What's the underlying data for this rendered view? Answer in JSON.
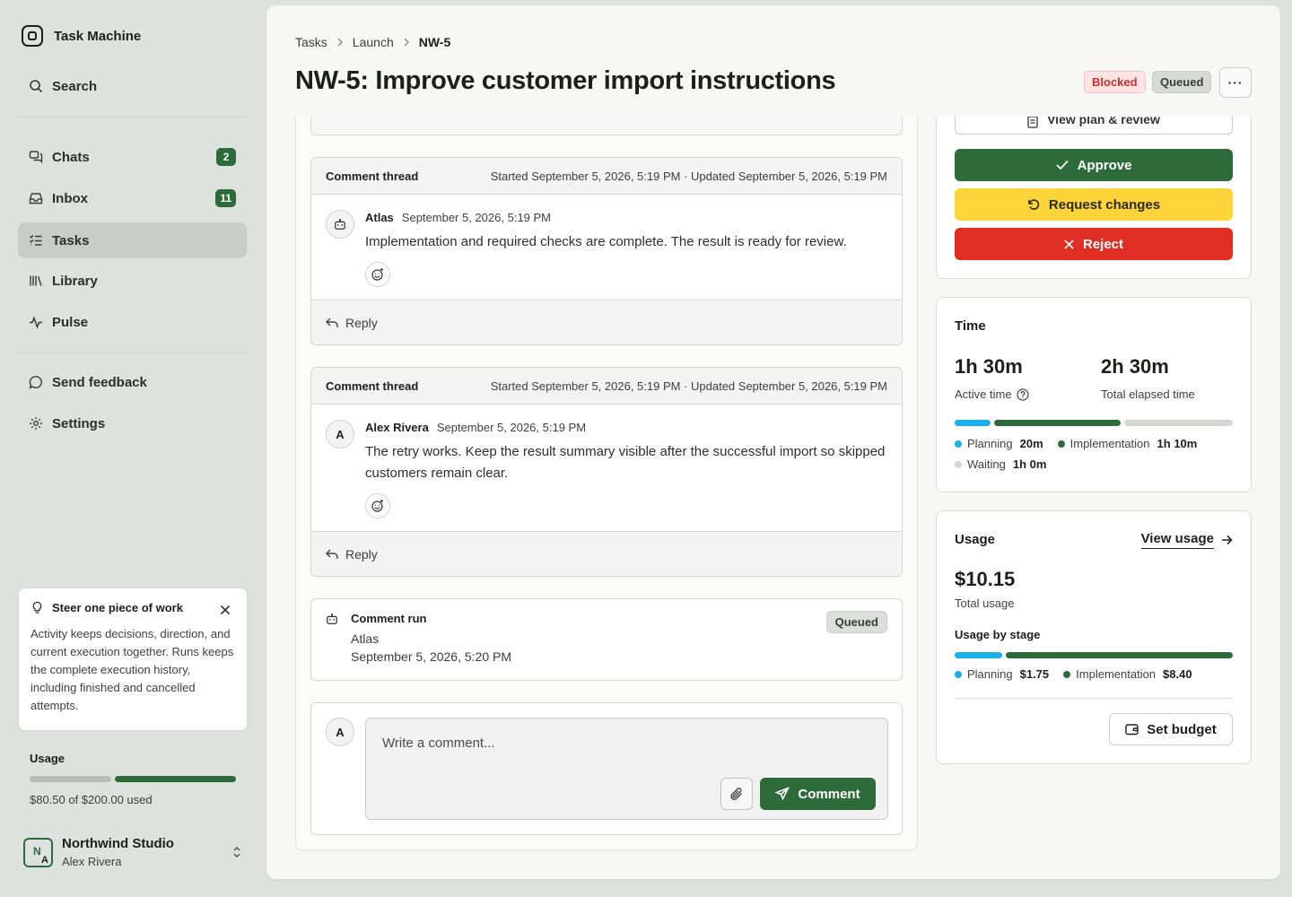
{
  "app": {
    "name": "Task Machine"
  },
  "sidebar": {
    "search_label": "Search",
    "items": [
      {
        "label": "Chats",
        "badge": "2"
      },
      {
        "label": "Inbox",
        "badge": "11"
      },
      {
        "label": "Tasks"
      },
      {
        "label": "Library"
      },
      {
        "label": "Pulse"
      }
    ],
    "feedback_label": "Send feedback",
    "settings_label": "Settings",
    "tip": {
      "title": "Steer one piece of work",
      "body": "Activity keeps decisions, direction, and current execution together. Runs keeps the complete execution history, including finished and cancelled attempts."
    },
    "usage": {
      "title": "Usage",
      "used_fraction": 0.4025,
      "text": "$80.50 of $200.00 used"
    },
    "workspace": {
      "name": "Northwind Studio",
      "user": "Alex Rivera",
      "initials_a": "N",
      "initials_b": "A"
    }
  },
  "header": {
    "breadcrumbs": [
      "Tasks",
      "Launch",
      "NW-5"
    ],
    "title": "NW-5: Improve customer import instructions",
    "status_blocked": "Blocked",
    "status_queued": "Queued",
    "more_label": "···"
  },
  "threads": [
    {
      "label": "Comment thread",
      "meta": "Started September 5, 2026, 5:19 PM · Updated September 5, 2026, 5:19 PM",
      "author": "Atlas",
      "time": "September 5, 2026, 5:19 PM",
      "text": "Implementation and required checks are complete. The result is ready for review.",
      "reply_label": "Reply"
    },
    {
      "label": "Comment thread",
      "meta": "Started September 5, 2026, 5:19 PM · Updated September 5, 2026, 5:19 PM",
      "author": "Alex Rivera",
      "avatar": "A",
      "time": "September 5, 2026, 5:19 PM",
      "text": "The retry works. Keep the result summary visible after the successful import so skipped customers remain clear.",
      "reply_label": "Reply"
    }
  ],
  "run": {
    "title": "Comment run",
    "agent": "Atlas",
    "time": "September 5, 2026, 5:20 PM",
    "status": "Queued"
  },
  "composer": {
    "avatar": "A",
    "placeholder": "Write a comment...",
    "submit_label": "Comment"
  },
  "review": {
    "view_plan_label": "View plan & review",
    "approve_label": "Approve",
    "request_changes_label": "Request changes",
    "reject_label": "Reject"
  },
  "time_panel": {
    "title": "Time",
    "active_value": "1h 30m",
    "active_label": "Active time",
    "total_value": "2h 30m",
    "total_label": "Total elapsed time",
    "stages": [
      {
        "name": "Planning",
        "value": "20m",
        "minutes": 20,
        "color": "#1ab0e8"
      },
      {
        "name": "Implementation",
        "value": "1h 10m",
        "minutes": 70,
        "color": "#2e6b3a"
      },
      {
        "name": "Waiting",
        "value": "1h 0m",
        "minutes": 60,
        "color": "#d4d6d4"
      }
    ]
  },
  "usage_panel": {
    "title": "Usage",
    "view_label": "View usage",
    "total_value": "$10.15",
    "total_label": "Total usage",
    "by_stage_label": "Usage by stage",
    "stages": [
      {
        "name": "Planning",
        "value": "$1.75",
        "amount": 1.75,
        "color": "#1ab0e8"
      },
      {
        "name": "Implementation",
        "value": "$8.40",
        "amount": 8.4,
        "color": "#2e6b3a"
      }
    ],
    "budget_label": "Set budget"
  },
  "colors": {
    "accent": "#2e6b3a",
    "warning": "#fdd53a",
    "danger": "#e02e25",
    "planning": "#1ab0e8"
  }
}
